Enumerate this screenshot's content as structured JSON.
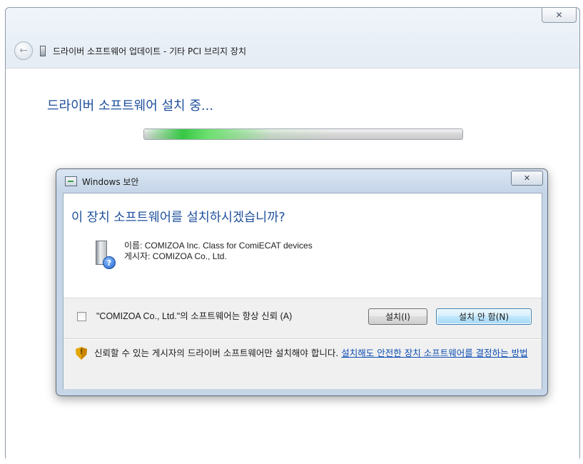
{
  "outer_window": {
    "close_label": "✕",
    "back_icon": "back-arrow-icon",
    "title": "드라이버 소프트웨어 업데이트 - 기타 PCI 브리지 장치",
    "installing_title": "드라이버 소프트웨어 설치 중...",
    "progress_fraction": 0.12
  },
  "security_dialog": {
    "title": "Windows 보안",
    "close_label": "✕",
    "question": "이 장치 소프트웨어를 설치하시겠습니까?",
    "name_line": "이름: COMIZOA Inc. Class for ComiECAT devices",
    "publisher_line": "게시자: COMIZOA Co., Ltd.",
    "always_trust_label": "\"COMIZOA Co., Ltd.\"의 소프트웨어는 항상 신뢰 (A)",
    "always_trust_checked": false,
    "install_button": "설치(I)",
    "dont_install_button": "설치 안 함(N)",
    "warning_text": "신뢰할 수 있는 게시자의 드라이버 소프트웨어만 설치해야 합니다.",
    "warning_link": "설치해도 안전한 장치 소프트웨어를 결정하는 방법",
    "help_mark": "?",
    "warn_mark": "!"
  },
  "colors": {
    "heading_blue": "#1e4f9b",
    "link_blue": "#0f4fb3",
    "progress_green": "#37c745"
  }
}
